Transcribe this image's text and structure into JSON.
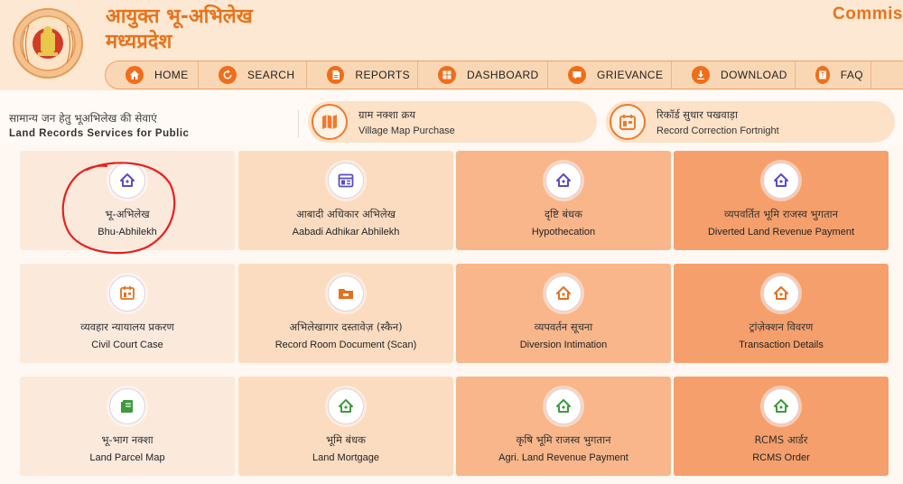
{
  "header": {
    "title_line1": "आयुक्त भू-अभिलेख",
    "title_line2": "मध्यप्रदेश",
    "right_title": "Commis"
  },
  "nav": [
    {
      "label": "HOME",
      "icon": "home-icon"
    },
    {
      "label": "SEARCH",
      "icon": "search-icon"
    },
    {
      "label": "REPORTS",
      "icon": "reports-icon"
    },
    {
      "label": "DASHBOARD",
      "icon": "dashboard-icon"
    },
    {
      "label": "GRIEVANCE",
      "icon": "grievance-icon"
    },
    {
      "label": "DOWNLOAD",
      "icon": "download-icon"
    },
    {
      "label": "FAQ",
      "icon": "faq-icon"
    }
  ],
  "strip": {
    "hindi": "सामान्य जन हेतु भूअभिलेख की सेवाएं",
    "english": "Land Records Services for Public"
  },
  "pills": [
    {
      "hindi": "ग्राम नक्शा क्रय",
      "english": "Village Map Purchase",
      "icon": "map-icon"
    },
    {
      "hindi": "रिकॉर्ड सुधार पखवाड़ा",
      "english": "Record Correction Fortnight",
      "icon": "record-icon"
    }
  ],
  "tiles": [
    {
      "hindi": "भू-अभिलेख",
      "english": "Bhu-Abhilekh",
      "icon": "house-icon"
    },
    {
      "hindi": "आबादी अधिकार अभिलेख",
      "english": "Aabadi Adhikar Abhilekh",
      "icon": "calendar-icon"
    },
    {
      "hindi": "दृष्टि बंधक",
      "english": "Hypothecation",
      "icon": "house-icon"
    },
    {
      "hindi": "व्यपवर्तित भूमि राजस्व भुगतान",
      "english": "Diverted Land Revenue Payment",
      "icon": "house-icon"
    },
    {
      "hindi": "व्यवहार न्यायालय प्रकरण",
      "english": "Civil Court Case",
      "icon": "document-icon"
    },
    {
      "hindi": "अभिलेखागार दस्तावेज़ (स्कैन)",
      "english": "Record Room Document (Scan)",
      "icon": "folder-icon"
    },
    {
      "hindi": "व्यपवर्तन सूचना",
      "english": "Diversion Intimation",
      "icon": "house-icon"
    },
    {
      "hindi": "ट्रांज़ेक्शन विवरण",
      "english": "Transaction Details",
      "icon": "house-icon"
    },
    {
      "hindi": "भू-भाग नक्शा",
      "english": "Land Parcel Map",
      "icon": "book-icon"
    },
    {
      "hindi": "भूमि बंधक",
      "english": "Land Mortgage",
      "icon": "house-icon"
    },
    {
      "hindi": "कृषि भूमि राजस्व भुगतान",
      "english": "Agri. Land Revenue Payment",
      "icon": "house-icon"
    },
    {
      "hindi": "RCMS आर्डर",
      "english": "RCMS Order",
      "icon": "house-icon"
    }
  ],
  "colors": {
    "accent_orange": "#e8731c",
    "icon_purple": "#5b4bc4",
    "icon_orange": "#e6701e",
    "icon_green": "#3e9a3c",
    "annotation_red": "#e8201e"
  }
}
